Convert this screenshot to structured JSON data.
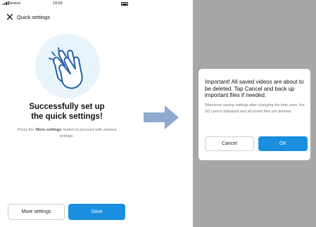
{
  "left_screen": {
    "status_bar": {
      "carrier": "Service",
      "time": "19:02"
    },
    "header": {
      "title": "Quick settings"
    },
    "success": {
      "title_line1": "Successfully set up",
      "title_line2": "the quick settings!",
      "desc_prefix": "Press the '",
      "desc_emphasis": "More settings",
      "desc_suffix": "' button to proceed with camera settings."
    },
    "buttons": {
      "more_settings": "More settings",
      "save": "Save"
    }
  },
  "right_screen": {
    "dialog": {
      "title": "Important!  All saved videos are about to be deleted. Tap Cancel and back up important files if needed.",
      "body": "Whenever saving settings after changing the time zone, the SD card is initialized and all stored files are deleted.",
      "cancel_label": "Cancel",
      "ok_label": "OK"
    }
  },
  "colors": {
    "accent": "#1a8fe0",
    "overlay": "#a7a7a7",
    "arrow": "#8fa9d0",
    "hero_bg": "#e9f3fb"
  },
  "icons": [
    "signal-icon",
    "battery-icon",
    "close-icon",
    "clapping-hands-icon",
    "arrow-right-icon"
  ]
}
